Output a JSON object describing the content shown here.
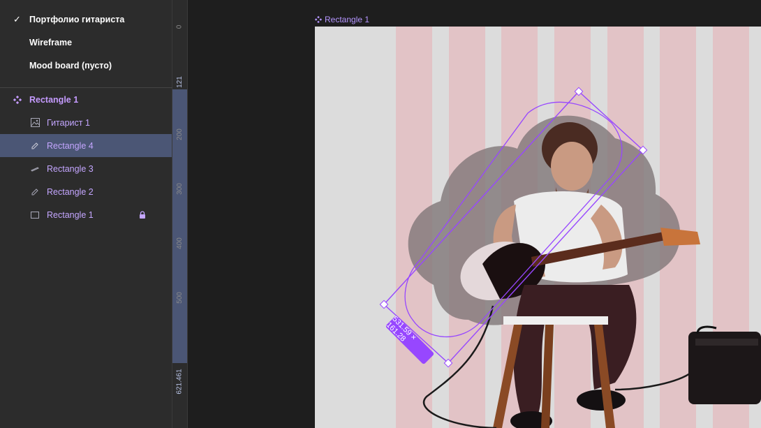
{
  "pages": [
    {
      "label": "Портфолио гитариста",
      "checked": true
    },
    {
      "label": "Wireframe",
      "checked": false
    },
    {
      "label": "Mood board (пусто)",
      "checked": false
    }
  ],
  "layers": [
    {
      "label": "Rectangle 1",
      "type": "frame",
      "icon": "frame-icon"
    },
    {
      "label": "Гитарист 1",
      "type": "image",
      "icon": "image-icon"
    },
    {
      "label": "Rectangle 4",
      "type": "vector",
      "icon": "pen-icon",
      "selected": true
    },
    {
      "label": "Rectangle 3",
      "type": "vector",
      "icon": "pen-icon"
    },
    {
      "label": "Rectangle 2",
      "type": "vector",
      "icon": "pen-icon"
    },
    {
      "label": "Rectangle 1",
      "type": "rectangle",
      "icon": "rectangle-icon",
      "locked": true
    }
  ],
  "ruler": {
    "ticks": [
      "0",
      "121",
      "200",
      "300",
      "400",
      "500",
      "621.461"
    ]
  },
  "canvas": {
    "frame_label": "Rectangle 1",
    "size_badge": "531.59 × 161.28"
  },
  "colors": {
    "accent": "#9747ff",
    "selection_row": "#4b5675",
    "stripe": "#e2c3c6",
    "artboard": "#dcdcdc"
  }
}
